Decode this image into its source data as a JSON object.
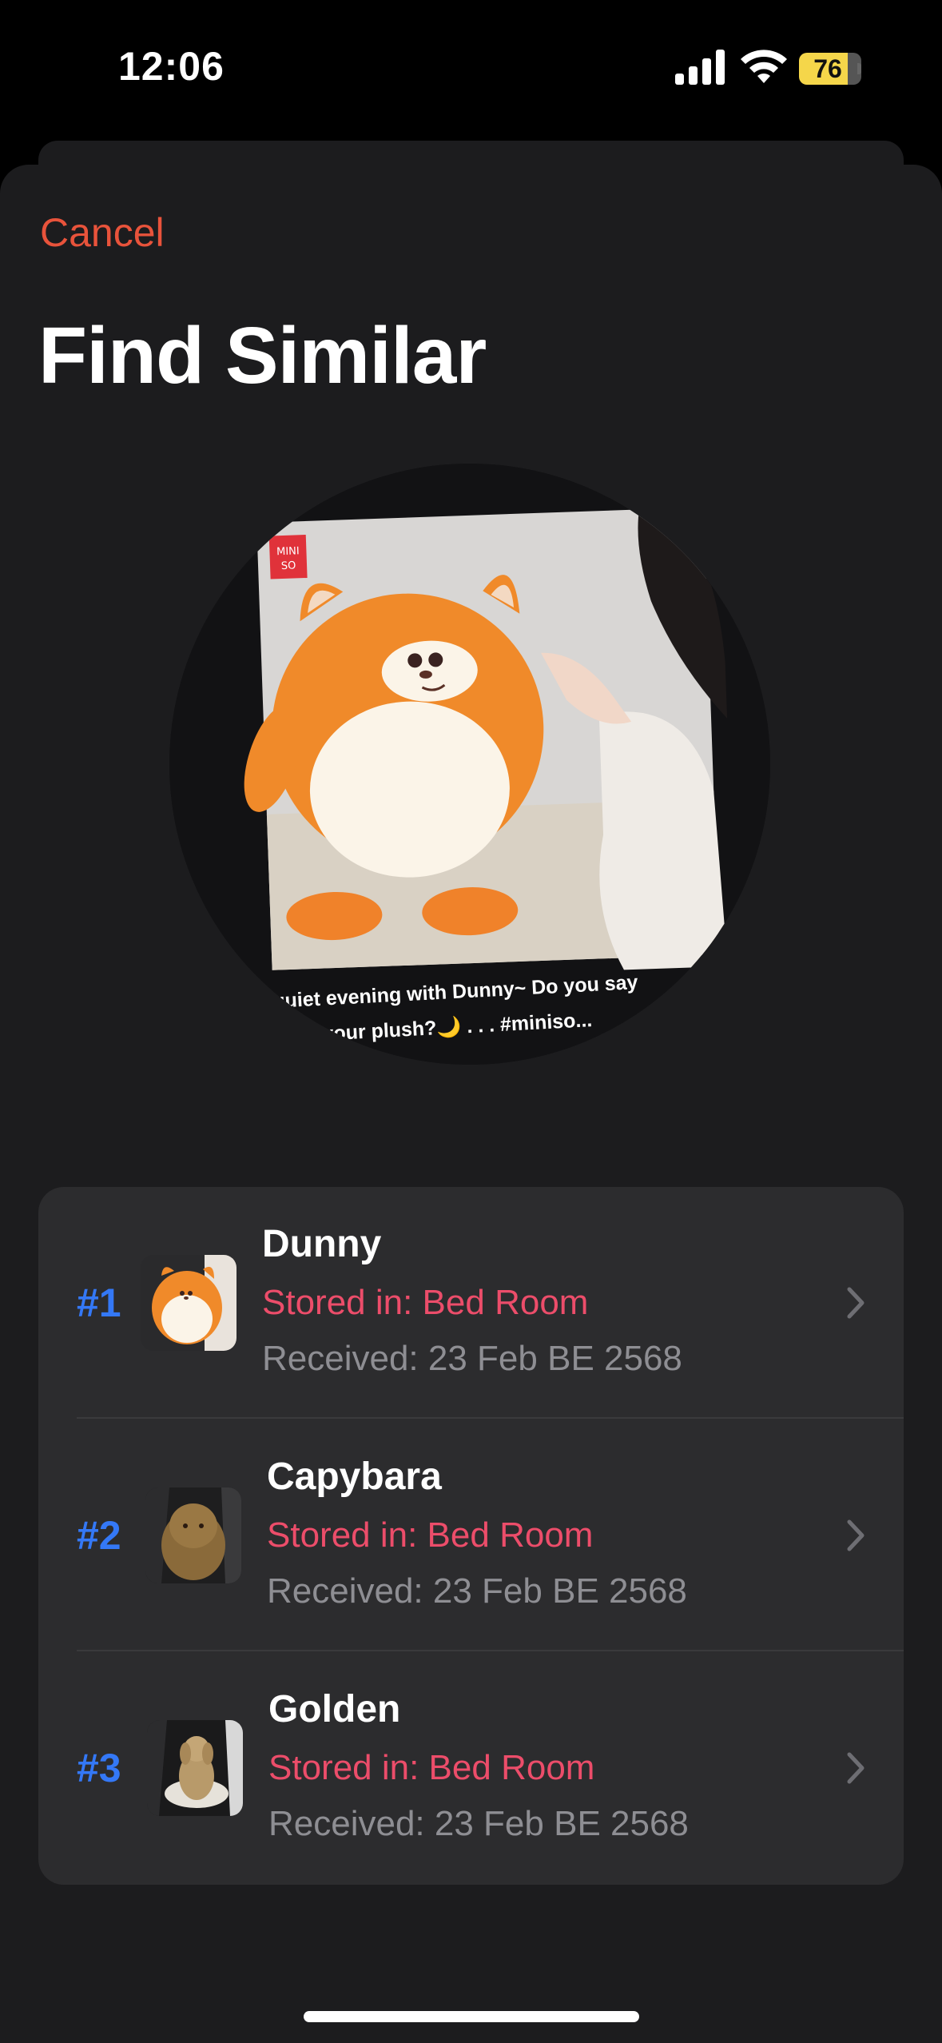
{
  "status_bar": {
    "time": "12:06",
    "battery_level": "76",
    "battery_fraction": 0.76
  },
  "header": {
    "cancel_label": "Cancel",
    "title": "Find Similar"
  },
  "hero": {
    "caption_line1": "quiet evening with Dunny~ Do you say",
    "caption_line2": "your plush?🌙 . . . #miniso...",
    "brand_badge": "MINI SO"
  },
  "results": [
    {
      "rank": "#1",
      "name": "Dunny",
      "stored": "Stored in: Bed Room",
      "received": "Received: 23 Feb BE 2568"
    },
    {
      "rank": "#2",
      "name": "Capybara",
      "stored": "Stored in: Bed Room",
      "received": "Received: 23 Feb BE 2568"
    },
    {
      "rank": "#3",
      "name": "Golden",
      "stored": "Stored in: Bed Room",
      "received": "Received: 23 Feb BE 2568"
    }
  ],
  "colors": {
    "accent_cancel": "#e8533b",
    "rank_blue": "#3478f6",
    "stored_pink": "#ec4d6a",
    "battery_yellow": "#f5d64a"
  }
}
